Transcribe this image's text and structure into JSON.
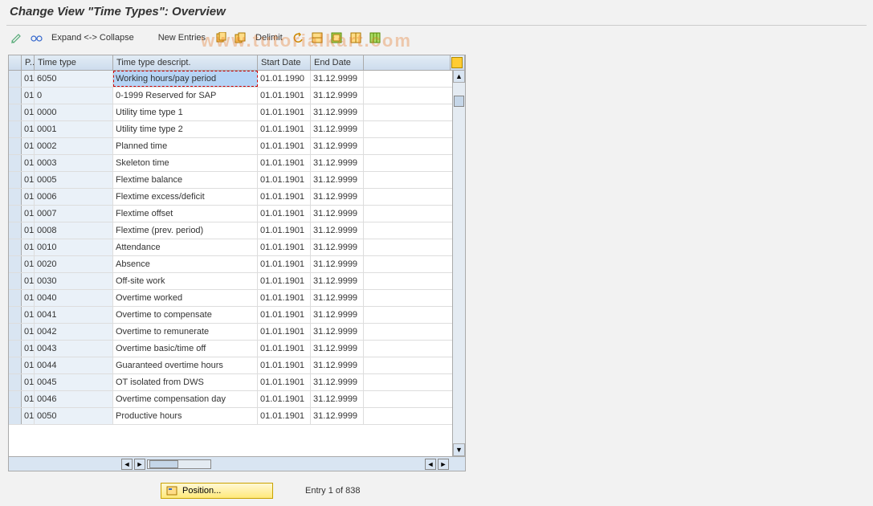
{
  "title": "Change View \"Time Types\": Overview",
  "watermark": "www.tutorialkart.com",
  "toolbar": {
    "expand_collapse": "Expand <-> Collapse",
    "new_entries": "New Entries",
    "delimit": "Delimit"
  },
  "columns": {
    "p": "P..",
    "time_type": "Time type",
    "descript": "Time type descript.",
    "start_date": "Start Date",
    "end_date": "End Date"
  },
  "rows": [
    {
      "p": "01",
      "tt": "6050",
      "desc": "Working hours/pay period",
      "sd": "01.01.1990",
      "ed": "31.12.9999",
      "sel": true
    },
    {
      "p": "01",
      "tt": "0",
      "desc": "0-1999 Reserved for SAP",
      "sd": "01.01.1901",
      "ed": "31.12.9999"
    },
    {
      "p": "01",
      "tt": "0000",
      "desc": "Utility time type 1",
      "sd": "01.01.1901",
      "ed": "31.12.9999"
    },
    {
      "p": "01",
      "tt": "0001",
      "desc": "Utility time type 2",
      "sd": "01.01.1901",
      "ed": "31.12.9999"
    },
    {
      "p": "01",
      "tt": "0002",
      "desc": "Planned time",
      "sd": "01.01.1901",
      "ed": "31.12.9999"
    },
    {
      "p": "01",
      "tt": "0003",
      "desc": "Skeleton time",
      "sd": "01.01.1901",
      "ed": "31.12.9999"
    },
    {
      "p": "01",
      "tt": "0005",
      "desc": "Flextime balance",
      "sd": "01.01.1901",
      "ed": "31.12.9999"
    },
    {
      "p": "01",
      "tt": "0006",
      "desc": "Flextime excess/deficit",
      "sd": "01.01.1901",
      "ed": "31.12.9999"
    },
    {
      "p": "01",
      "tt": "0007",
      "desc": "Flextime offset",
      "sd": "01.01.1901",
      "ed": "31.12.9999"
    },
    {
      "p": "01",
      "tt": "0008",
      "desc": "Flextime (prev. period)",
      "sd": "01.01.1901",
      "ed": "31.12.9999"
    },
    {
      "p": "01",
      "tt": "0010",
      "desc": "Attendance",
      "sd": "01.01.1901",
      "ed": "31.12.9999"
    },
    {
      "p": "01",
      "tt": "0020",
      "desc": "Absence",
      "sd": "01.01.1901",
      "ed": "31.12.9999"
    },
    {
      "p": "01",
      "tt": "0030",
      "desc": "Off-site work",
      "sd": "01.01.1901",
      "ed": "31.12.9999"
    },
    {
      "p": "01",
      "tt": "0040",
      "desc": "Overtime worked",
      "sd": "01.01.1901",
      "ed": "31.12.9999"
    },
    {
      "p": "01",
      "tt": "0041",
      "desc": "Overtime to compensate",
      "sd": "01.01.1901",
      "ed": "31.12.9999"
    },
    {
      "p": "01",
      "tt": "0042",
      "desc": "Overtime to remunerate",
      "sd": "01.01.1901",
      "ed": "31.12.9999"
    },
    {
      "p": "01",
      "tt": "0043",
      "desc": "Overtime basic/time off",
      "sd": "01.01.1901",
      "ed": "31.12.9999"
    },
    {
      "p": "01",
      "tt": "0044",
      "desc": "Guaranteed overtime hours",
      "sd": "01.01.1901",
      "ed": "31.12.9999"
    },
    {
      "p": "01",
      "tt": "0045",
      "desc": "OT isolated from DWS",
      "sd": "01.01.1901",
      "ed": "31.12.9999"
    },
    {
      "p": "01",
      "tt": "0046",
      "desc": "Overtime compensation day",
      "sd": "01.01.1901",
      "ed": "31.12.9999"
    },
    {
      "p": "01",
      "tt": "0050",
      "desc": "Productive hours",
      "sd": "01.01.1901",
      "ed": "31.12.9999"
    }
  ],
  "footer": {
    "position": "Position...",
    "status": "Entry 1 of 838"
  }
}
